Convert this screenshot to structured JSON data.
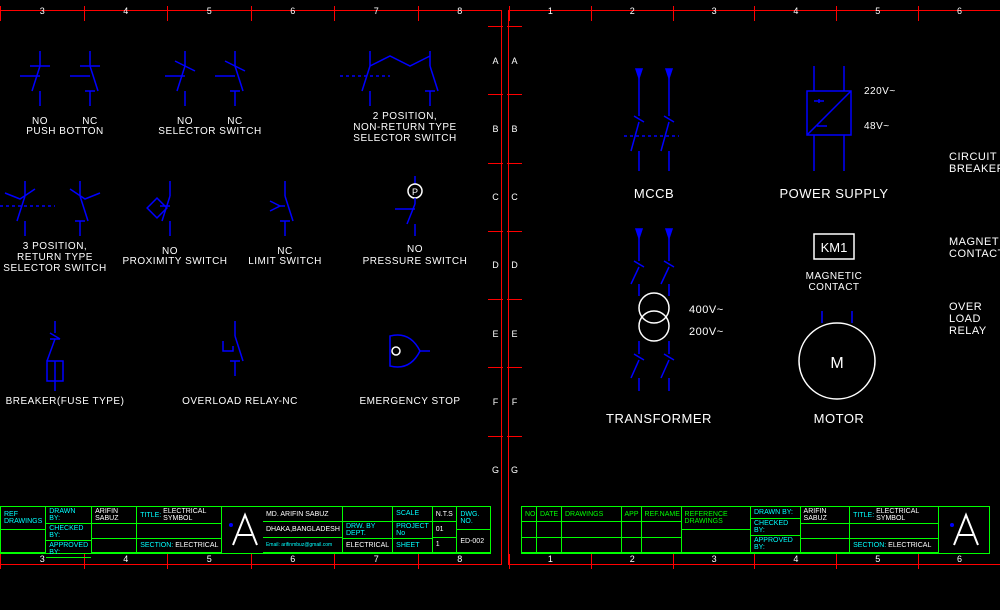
{
  "left_sheet": {
    "ruler_cols": [
      "3",
      "4",
      "5",
      "6",
      "7",
      "8"
    ],
    "ruler_rows": [
      "A",
      "B",
      "C",
      "D",
      "E",
      "F",
      "G"
    ],
    "symbols": [
      {
        "id": "push-no",
        "sub": "NO",
        "label": "PUSH BOTTON"
      },
      {
        "id": "push-nc",
        "sub": "NC",
        "label": ""
      },
      {
        "id": "sel-no",
        "sub": "NO",
        "label": "SELECTOR SWITCH"
      },
      {
        "id": "sel-nc",
        "sub": "NC",
        "label": ""
      },
      {
        "id": "sel-2pos",
        "label": "2 POSITION,\nNON-RETURN TYPE\nSELECTOR SWITCH"
      },
      {
        "id": "sel-3pos",
        "label": "3 POSITION,\nRETURN TYPE\nSELECTOR SWITCH"
      },
      {
        "id": "prox",
        "sub": "NO",
        "label": "PROXIMITY SWITCH"
      },
      {
        "id": "limit",
        "sub": "NC",
        "label": "LIMIT SWITCH"
      },
      {
        "id": "pressure",
        "sub": "NO",
        "label": "PRESSURE SWITCH"
      },
      {
        "id": "breaker-fuse",
        "label": "BREAKER(FUSE TYPE)"
      },
      {
        "id": "overload-nc",
        "label": "OVERLOAD RELAY-NC"
      },
      {
        "id": "estop",
        "label": "EMERGENCY STOP"
      }
    ],
    "title_block": {
      "ref_drawings": "REF DRAWINGS",
      "drawn_by_label": "DRAWN BY:",
      "drawn_by": "ARIFIN SABUZ",
      "checked_by_label": "CHECKED BY:",
      "approved_by_label": "APPROVED BY:",
      "title_label": "TITLE:",
      "title": "ELECTRICAL SYMBOL",
      "section_label": "SECTION:",
      "section": "ELECTRICAL",
      "address1": "MD. ARIFIN SABUZ",
      "address2": "DHAKA,BANGLADESH",
      "email": "Email: arifinmbuz@gmail.com",
      "drw_by_dept_label": "DRW. BY DEPT.",
      "drw_by_dept": "ELECTRICAL",
      "scale_label": "SCALE",
      "scale": "N.T.S",
      "project_label": "PROJECT No",
      "project": "01",
      "sheet_label": "SHEET",
      "sheet": "1",
      "dwg_no_label": "DWG. NO.",
      "dwg_no": "ED-002"
    }
  },
  "right_sheet": {
    "ruler_cols": [
      "1",
      "2",
      "3",
      "4",
      "5",
      "6"
    ],
    "ruler_rows": [
      "A",
      "B",
      "C",
      "D",
      "E",
      "F",
      "G"
    ],
    "symbols": [
      {
        "id": "mccb",
        "label": "MCCB"
      },
      {
        "id": "power-supply",
        "label": "POWER SUPPLY",
        "v1": "220V~",
        "v2": "48V~"
      },
      {
        "id": "circuit-breaker",
        "label": "CIRCUIT\nBREAKER"
      },
      {
        "id": "transformer",
        "label": "TRANSFORMER",
        "v1": "400V~",
        "v2": "200V~"
      },
      {
        "id": "magnetic-contact",
        "label": "MAGNETIC\nCONTACT",
        "tag": "KM1",
        "side_label": "MAGNETIC\nCONTACT"
      },
      {
        "id": "motor",
        "label": "MOTOR",
        "tag": "M"
      },
      {
        "id": "overload-relay",
        "label": "OVER LOAD\nRELAY"
      }
    ],
    "title_block": {
      "no": "NO",
      "date": "DATE",
      "drawings": "DRAWINGS",
      "app": "APP",
      "ref": "REF.NAME",
      "ref_drawings_label": "REFERENCE DRAWINGS",
      "drawn_by_label": "DRAWN BY:",
      "drawn_by": "ARIFIN SABUZ",
      "checked_by_label": "CHECKED BY:",
      "approved_by_label": "APPROVED BY:",
      "title_label": "TITLE:",
      "title": "ELECTRICAL SYMBOL",
      "section_label": "SECTION:",
      "section": "ELECTRICAL"
    }
  }
}
